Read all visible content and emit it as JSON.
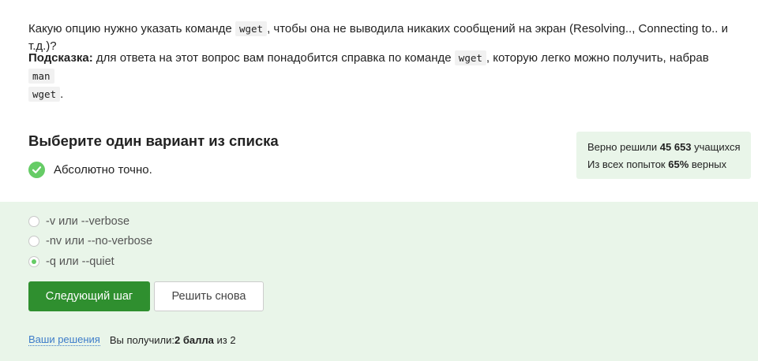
{
  "question": {
    "text_before": "Какую опцию нужно указать команде ",
    "code": "wget",
    "text_after": ", чтобы она не выводила никаких сообщений на экран (Resolving.., Connecting to.. и т.д.)?"
  },
  "hint": {
    "label": "Подсказка:",
    "text1": " для ответа на этот вопрос вам понадобится справка по команде ",
    "code1": "wget",
    "text2": ", которую легко можно получить, набрав ",
    "code2a": "man",
    "code2b": "wget",
    "text3": "."
  },
  "choose_title": "Выберите один вариант из списка",
  "result": {
    "text": "Абсолютно точно."
  },
  "stats": {
    "line1_prefix": "Верно решили ",
    "solved_count": "45 653",
    "line1_suffix": " учащихся",
    "line2_prefix": "Из всех попыток ",
    "percent": "65%",
    "line2_suffix": " верных"
  },
  "options": [
    {
      "label": "-v или --verbose",
      "checked": false
    },
    {
      "label": "-nv или --no-verbose",
      "checked": false
    },
    {
      "label": "-q или --quiet",
      "checked": true
    }
  ],
  "buttons": {
    "next": "Следующий шаг",
    "retry": "Решить снова"
  },
  "footer": {
    "link": "Ваши решения",
    "received_prefix": "Вы получили: ",
    "score": "2 балла",
    "received_suffix": " из 2"
  },
  "colors": {
    "accent_green": "#2f8f2f",
    "success_green": "#66cc66",
    "panel_bg": "#e9f5e9",
    "link_blue": "#3d7cc9"
  }
}
